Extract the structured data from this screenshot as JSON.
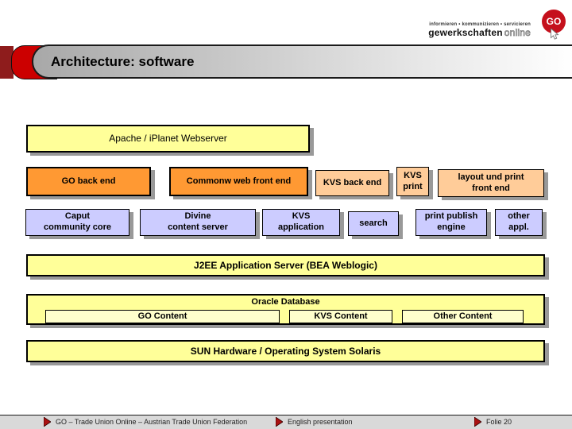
{
  "header": {
    "title": "Architecture: software"
  },
  "logo": {
    "tagline": "informieren • kommunizieren • servicieren",
    "brand_bold": "gewerkschaften",
    "brand_light": "online",
    "badge": "GO"
  },
  "diagram": {
    "webserver_label": "Apache / iPlanet Webserver",
    "backend_row": [
      {
        "label": "GO back end",
        "tone": "orange"
      },
      {
        "label": "Commonw web front end",
        "tone": "orange"
      },
      {
        "label": "KVS back end",
        "tone": "peach"
      },
      {
        "label": "KVS\nprint",
        "tone": "peach"
      },
      {
        "label": "layout und print\nfront end",
        "tone": "peach"
      }
    ],
    "app_row": [
      {
        "label": "Caput\ncommunity core"
      },
      {
        "label": "Divine\ncontent server"
      },
      {
        "label": "KVS\napplication"
      },
      {
        "label": "search"
      },
      {
        "label": "print publish\nengine"
      },
      {
        "label": "other\nappl."
      }
    ],
    "app_server_label": "J2EE Application Server (BEA Weblogic)",
    "database": {
      "title": "Oracle Database",
      "contents": [
        {
          "label": "GO Content"
        },
        {
          "label": "KVS Content"
        },
        {
          "label": "Other Content"
        }
      ]
    },
    "hardware_label": "SUN Hardware / Operating System Solaris"
  },
  "footer": {
    "items": [
      {
        "label": "GO – Trade Union Online – Austrian Trade Union Federation"
      },
      {
        "label": "English presentation"
      },
      {
        "label": "Folie 20"
      }
    ]
  },
  "colors": {
    "box_yellow": "#FFFF99",
    "box_light_yellow": "#FFFFCC",
    "box_orange": "#FF9933",
    "box_peach": "#FFCC99",
    "box_lavender": "#CCCCFF",
    "accent_red": "#CC0000",
    "dark_red": "#8E1C1C",
    "shadow_gray": "#999999",
    "footer_gray": "#D9D9D9"
  }
}
